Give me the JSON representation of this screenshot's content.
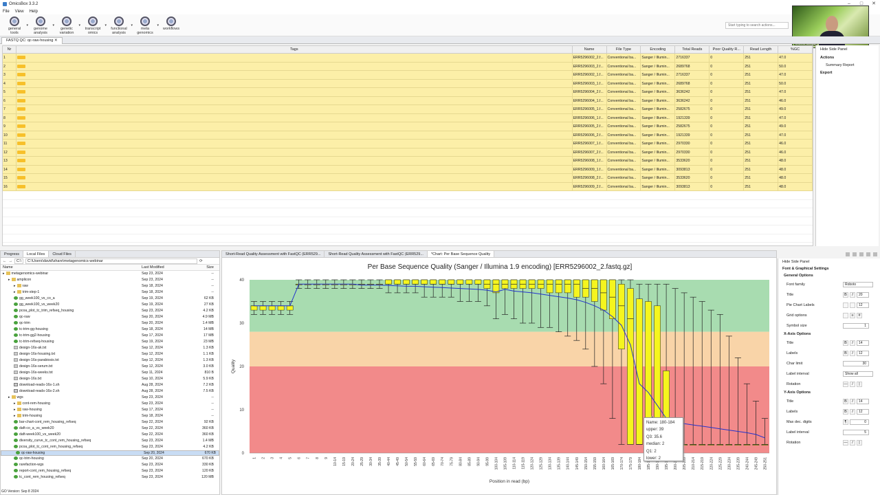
{
  "app": {
    "title": "OmicsBox 3.3.2"
  },
  "menu": [
    "File",
    "View",
    "Help"
  ],
  "toolbar": [
    {
      "label": "general\ntools",
      "icon": "general-tools-icon"
    },
    {
      "label": "genome\nanalysis",
      "icon": "genome-analysis-icon"
    },
    {
      "label": "genetic\nvariation",
      "icon": "genetic-variation-icon"
    },
    {
      "label": "transcript\nomics",
      "icon": "transcriptomics-icon"
    },
    {
      "label": "functional\nanalysis",
      "icon": "functional-analysis-icon"
    },
    {
      "label": "meta\ngenomics",
      "icon": "metagenomics-icon"
    },
    {
      "label": "workflows",
      "icon": "workflows-icon"
    }
  ],
  "search": {
    "placeholder": "Start typing to search actions..."
  },
  "webcam": {
    "name": "David Seide"
  },
  "doc_tab": {
    "label": "FASTQ QC: qc-raw-housing"
  },
  "table": {
    "columns": [
      "Nr",
      "Tags",
      "Name",
      "File Type",
      "Encoding",
      "Total Reads",
      "Poor Quality R...",
      "Read Length",
      "%GC"
    ],
    "rows": [
      [
        "1",
        "ERR5296002_2.f...",
        "Conventional ba...",
        "Sanger / Illumin...",
        "2716337",
        "0",
        "251",
        "47.0"
      ],
      [
        "2",
        "ERR5296003_2.f...",
        "Conventional ba...",
        "Sanger / Illumin...",
        "2689768",
        "0",
        "251",
        "50.0"
      ],
      [
        "3",
        "ERR5296002_1.f...",
        "Conventional ba...",
        "Sanger / Illumin...",
        "2716337",
        "0",
        "251",
        "47.0"
      ],
      [
        "4",
        "ERR5296003_1.f...",
        "Conventional ba...",
        "Sanger / Illumin...",
        "2689768",
        "0",
        "251",
        "50.0"
      ],
      [
        "5",
        "ERR5296004_2.f...",
        "Conventional ba...",
        "Sanger / Illumin...",
        "3636242",
        "0",
        "251",
        "47.0"
      ],
      [
        "6",
        "ERR5296004_1.f...",
        "Conventional ba...",
        "Sanger / Illumin...",
        "3636242",
        "0",
        "251",
        "46.0"
      ],
      [
        "7",
        "ERR5296005_1.f...",
        "Conventional ba...",
        "Sanger / Illumin...",
        "2582675",
        "0",
        "251",
        "49.0"
      ],
      [
        "8",
        "ERR5296006_1.f...",
        "Conventional ba...",
        "Sanger / Illumin...",
        "1921339",
        "0",
        "251",
        "47.0"
      ],
      [
        "9",
        "ERR5296005_2.f...",
        "Conventional ba...",
        "Sanger / Illumin...",
        "2582675",
        "0",
        "251",
        "49.0"
      ],
      [
        "10",
        "ERR5296006_2.f...",
        "Conventional ba...",
        "Sanger / Illumin...",
        "1921339",
        "0",
        "251",
        "47.0"
      ],
      [
        "11",
        "ERR5296007_1.f...",
        "Conventional ba...",
        "Sanger / Illumin...",
        "2970330",
        "0",
        "251",
        "46.0"
      ],
      [
        "12",
        "ERR5296007_2.f...",
        "Conventional ba...",
        "Sanger / Illumin...",
        "2970330",
        "0",
        "251",
        "46.0"
      ],
      [
        "13",
        "ERR5296008_1.f...",
        "Conventional ba...",
        "Sanger / Illumin...",
        "3533620",
        "0",
        "251",
        "48.0"
      ],
      [
        "14",
        "ERR5296009_1.f...",
        "Conventional ba...",
        "Sanger / Illumin...",
        "3093813",
        "0",
        "251",
        "48.0"
      ],
      [
        "15",
        "ERR5296008_2.f...",
        "Conventional ba...",
        "Sanger / Illumin...",
        "3533620",
        "0",
        "251",
        "48.0"
      ],
      [
        "16",
        "ERR5296009_2.f...",
        "Conventional ba...",
        "Sanger / Illumin...",
        "3093813",
        "0",
        "251",
        "48.0"
      ]
    ]
  },
  "right_panel": {
    "hide": "Hide Side Panel",
    "actions": "Actions",
    "summary": "Summary Report",
    "export": "Export"
  },
  "bottom_left": {
    "tabs": [
      "Progress",
      "Local Files",
      "Cloud Files"
    ],
    "drive": "C:\\",
    "path": "C:\\Users\\david\\share\\metagenomics-webinar",
    "columns": [
      "Name",
      "Last Modified",
      "Size"
    ],
    "files": [
      [
        "metagenomics-webinar",
        "Sep 23, 2024",
        "--",
        "fold",
        0
      ],
      [
        "amplicon",
        "Sep 23, 2024",
        "--",
        "fold",
        1
      ],
      [
        "raw",
        "Sep 18, 2024",
        "--",
        "fold",
        2
      ],
      [
        "trim-step-1",
        "Sep 18, 2024",
        "--",
        "fold",
        2
      ],
      [
        "gg_week100_vs_co_a",
        "Sep 19, 2024",
        "62 KB",
        "fqc",
        2
      ],
      [
        "gg_week100_vs_week20",
        "Sep 19, 2024",
        "27 KB",
        "fqc",
        2
      ],
      [
        "pcoa_plot_tc_trim_refseq_housing",
        "Sep 23, 2024",
        "4.2 KB",
        "fqc",
        2
      ],
      [
        "qc-raw",
        "Sep 20, 2024",
        "4.9 MB",
        "fqc",
        2
      ],
      [
        "qc-trim",
        "Sep 20, 2024",
        "1.4 MB",
        "fqc",
        2
      ],
      [
        "tc-trim-gg-housing",
        "Sep 18, 2024",
        "14 MB",
        "fqc",
        2
      ],
      [
        "tc-trim-gg2-housing",
        "Sep 17, 2024",
        "17 MB",
        "fqc",
        2
      ],
      [
        "tc-trim-refseq-housing",
        "Sep 19, 2024",
        "23 MB",
        "fqc",
        2
      ],
      [
        "design-16s-ak.txt",
        "Sep 12, 2024",
        "1.3 KB",
        "fdoc",
        2
      ],
      [
        "design-16s-housing.txt",
        "Sep 12, 2024",
        "1.1 KB",
        "fdoc",
        2
      ],
      [
        "design-16s-parabiosis.txt",
        "Sep 12, 2024",
        "1.3 KB",
        "fdoc",
        2
      ],
      [
        "design-16s-serum.txt",
        "Sep 12, 2024",
        "3.0 KB",
        "fdoc",
        2
      ],
      [
        "design-16s-weeks.txt",
        "Sep 11, 2024",
        "810 B",
        "fdoc",
        2
      ],
      [
        "design-16s.txt",
        "Sep 10, 2024",
        "5.9 KB",
        "fdoc",
        2
      ],
      [
        "download-reads-16s-1.sh",
        "Aug 28, 2024",
        "7.2 KB",
        "fsh",
        2
      ],
      [
        "download-reads-16s-2.sh",
        "Aug 28, 2024",
        "7.5 KB",
        "fsh",
        2
      ],
      [
        "wgs",
        "Sep 23, 2024",
        "--",
        "fold",
        1
      ],
      [
        "cont-rem-housing",
        "Sep 23, 2024",
        "--",
        "fold",
        2
      ],
      [
        "raw-housing",
        "Sep 17, 2024",
        "--",
        "fold",
        2
      ],
      [
        "trim-housing",
        "Sep 18, 2024",
        "--",
        "fold",
        2
      ],
      [
        "bar-chart-cont_rem_housing_refseq",
        "Sep 22, 2024",
        "92 KB",
        "fqc",
        2
      ],
      [
        "daft-co_a_vs_week20",
        "Sep 22, 2024",
        "360 KB",
        "fqc",
        2
      ],
      [
        "daft-week100_vs_week20",
        "Sep 22, 2024",
        "360 KB",
        "fqc",
        2
      ],
      [
        "diversity_curve_tc_cont_rem_housing_refseq",
        "Sep 23, 2024",
        "1.4 MB",
        "fqc",
        2
      ],
      [
        "pcoa_plot_tc_cont_rem_housing_refseq",
        "Sep 23, 2024",
        "4.2 KB",
        "fqc",
        2
      ],
      [
        "qc-raw-housing",
        "Sep 20, 2024",
        "670 KB",
        "fqc",
        2
      ],
      [
        "qc-trim-housing",
        "Sep 20, 2024",
        "670 KB",
        "fqc",
        2
      ],
      [
        "rarefaction-wgs",
        "Sep 23, 2024",
        "330 KB",
        "fqc",
        2
      ],
      [
        "report-cont_rem_housing_refseq",
        "Sep 23, 2024",
        "120 KB",
        "fqc",
        2
      ],
      [
        "tc_cont_rem_housing_refseq",
        "Sep 23, 2024",
        "120 MB",
        "fqc",
        2
      ]
    ],
    "selected": "qc-raw-housing",
    "status": "GO Version: Sep 8 2024"
  },
  "chart_tabs": [
    "Short-Read Quality Assessment with FastQC (ERR529...",
    "Short-Read Quality Assessment with FastQC (ERR529...",
    "*Chart: Per Base Sequence Quality"
  ],
  "colors": {
    "good": "#a8dcb0",
    "warn": "#f9d4a8",
    "bad": "#f28a8a",
    "box": "#f5f51e",
    "mean": "#2233cc"
  },
  "tooltip": {
    "lines": [
      "Name: 180-184",
      "upper: 39",
      "Q3: 35.6",
      "median: 2",
      "Q1: 2",
      "lower: 2"
    ]
  },
  "side_panel": {
    "hide": "Hide Side Panel",
    "section": "Font & Graphical Settings",
    "general": "General Options",
    "font_family": "Font family",
    "font_value": "Roboto",
    "title": "Title",
    "title_size": "20",
    "pie": "Pie Chart Labels",
    "pie_size": "12",
    "grid": "Grid options",
    "symbol": "Symbol size",
    "symbol_value": "1",
    "xaxis": "X-Axis Options",
    "x_title": "Title",
    "x_title_size": "14",
    "x_labels": "Labels",
    "x_labels_size": "12",
    "char_limit": "Char limit",
    "char_value": "30",
    "label_interval": "Label interval",
    "label_interval_value": "Show all",
    "rotation": "Rotation",
    "yaxis": "Y-Axis Options",
    "y_title": "Title",
    "y_title_size": "14",
    "y_labels": "Labels",
    "y_labels_size": "12",
    "max_dec": "Max dec. digits",
    "max_dec_value": "0",
    "y_interval": "Label interval",
    "y_interval_value": "5",
    "y_rotation": "Rotation"
  },
  "chart_data": {
    "type": "box",
    "title": "Per Base Sequence Quality (Sanger / Illumina 1.9 encoding) [ERR5296002_2.fastq.gz]",
    "xlabel": "Position in read (bp)",
    "ylabel": "Quality",
    "ylim": [
      0,
      40
    ],
    "yticks": [
      0,
      10,
      20,
      30,
      40
    ],
    "zones": [
      {
        "from": 28,
        "to": 40,
        "color": "good"
      },
      {
        "from": 20,
        "to": 28,
        "color": "warn"
      },
      {
        "from": 0,
        "to": 20,
        "color": "bad"
      }
    ],
    "categories": [
      "1",
      "2",
      "3",
      "4",
      "5",
      "6",
      "7",
      "8",
      "9",
      "10-14",
      "15-19",
      "20-24",
      "25-29",
      "30-34",
      "35-39",
      "40-44",
      "45-49",
      "50-54",
      "55-59",
      "60-64",
      "65-69",
      "70-74",
      "75-79",
      "80-84",
      "85-89",
      "90-94",
      "95-99",
      "100-104",
      "105-109",
      "110-114",
      "115-119",
      "120-124",
      "125-129",
      "130-134",
      "135-139",
      "140-144",
      "145-149",
      "150-154",
      "155-159",
      "160-164",
      "165-169",
      "170-174",
      "175-179",
      "180-184",
      "185-189",
      "190-194",
      "195-199",
      "200-204",
      "205-209",
      "210-214",
      "215-219",
      "220-224",
      "225-229",
      "230-234",
      "235-239",
      "240-244",
      "245-249",
      "250-251"
    ],
    "boxes": [
      {
        "q1": 33,
        "med": 34,
        "q3": 34,
        "lo": 32,
        "hi": 35
      },
      {
        "q1": 33,
        "med": 34,
        "q3": 34,
        "lo": 32,
        "hi": 35
      },
      {
        "q1": 33,
        "med": 34,
        "q3": 34,
        "lo": 32,
        "hi": 35
      },
      {
        "q1": 33,
        "med": 34,
        "q3": 34,
        "lo": 32,
        "hi": 35
      },
      {
        "q1": 33,
        "med": 34,
        "q3": 34,
        "lo": 32,
        "hi": 35
      },
      {
        "q1": 39,
        "med": 39,
        "q3": 39,
        "lo": 38,
        "hi": 40
      },
      {
        "q1": 39,
        "med": 39,
        "q3": 39,
        "lo": 38,
        "hi": 40
      },
      {
        "q1": 39,
        "med": 39,
        "q3": 39,
        "lo": 38,
        "hi": 40
      },
      {
        "q1": 39,
        "med": 39,
        "q3": 39,
        "lo": 38,
        "hi": 40
      },
      {
        "q1": 39,
        "med": 39,
        "q3": 39,
        "lo": 38,
        "hi": 40
      },
      {
        "q1": 39,
        "med": 39,
        "q3": 39,
        "lo": 38,
        "hi": 40
      },
      {
        "q1": 39,
        "med": 39,
        "q3": 39,
        "lo": 38,
        "hi": 40
      },
      {
        "q1": 39,
        "med": 39,
        "q3": 39,
        "lo": 38,
        "hi": 40
      },
      {
        "q1": 39,
        "med": 39,
        "q3": 39,
        "lo": 38,
        "hi": 40
      },
      {
        "q1": 39,
        "med": 39,
        "q3": 39,
        "lo": 38,
        "hi": 40
      },
      {
        "q1": 39,
        "med": 39,
        "q3": 40,
        "lo": 37,
        "hi": 40
      },
      {
        "q1": 39,
        "med": 39,
        "q3": 40,
        "lo": 37,
        "hi": 40
      },
      {
        "q1": 39,
        "med": 39,
        "q3": 40,
        "lo": 37,
        "hi": 40
      },
      {
        "q1": 39,
        "med": 39,
        "q3": 40,
        "lo": 37,
        "hi": 40
      },
      {
        "q1": 39,
        "med": 39,
        "q3": 40,
        "lo": 36,
        "hi": 40
      },
      {
        "q1": 39,
        "med": 39,
        "q3": 40,
        "lo": 36,
        "hi": 40
      },
      {
        "q1": 39,
        "med": 39,
        "q3": 40,
        "lo": 36,
        "hi": 40
      },
      {
        "q1": 39,
        "med": 39,
        "q3": 40,
        "lo": 36,
        "hi": 40
      },
      {
        "q1": 39,
        "med": 39,
        "q3": 40,
        "lo": 35,
        "hi": 40
      },
      {
        "q1": 39,
        "med": 39,
        "q3": 40,
        "lo": 35,
        "hi": 40
      },
      {
        "q1": 39,
        "med": 39,
        "q3": 40,
        "lo": 35,
        "hi": 40
      },
      {
        "q1": 38,
        "med": 39,
        "q3": 40,
        "lo": 34,
        "hi": 40
      },
      {
        "q1": 37,
        "med": 39,
        "q3": 40,
        "lo": 31,
        "hi": 40
      },
      {
        "q1": 38,
        "med": 39,
        "q3": 40,
        "lo": 32,
        "hi": 40
      },
      {
        "q1": 38,
        "med": 39,
        "q3": 40,
        "lo": 31,
        "hi": 40
      },
      {
        "q1": 38,
        "med": 39,
        "q3": 40,
        "lo": 30,
        "hi": 40
      },
      {
        "q1": 38,
        "med": 39,
        "q3": 40,
        "lo": 30,
        "hi": 40
      },
      {
        "q1": 38,
        "med": 39,
        "q3": 40,
        "lo": 29,
        "hi": 40
      },
      {
        "q1": 37,
        "med": 39,
        "q3": 40,
        "lo": 29,
        "hi": 40
      },
      {
        "q1": 37,
        "med": 39,
        "q3": 40,
        "lo": 28,
        "hi": 40
      },
      {
        "q1": 37,
        "med": 39,
        "q3": 40,
        "lo": 27,
        "hi": 40
      },
      {
        "q1": 36,
        "med": 39,
        "q3": 40,
        "lo": 26,
        "hi": 40
      },
      {
        "q1": 36,
        "med": 38,
        "q3": 40,
        "lo": 24,
        "hi": 40
      },
      {
        "q1": 35,
        "med": 38,
        "q3": 40,
        "lo": 20,
        "hi": 40
      },
      {
        "q1": 33,
        "med": 37,
        "q3": 40,
        "lo": 16,
        "hi": 40
      },
      {
        "q1": 31,
        "med": 36,
        "q3": 40,
        "lo": 8,
        "hi": 40
      },
      {
        "q1": 24,
        "med": 34,
        "q3": 39,
        "lo": 2,
        "hi": 40
      },
      {
        "q1": 2,
        "med": 31,
        "q3": 38,
        "lo": 2,
        "hi": 40
      },
      {
        "q1": 2,
        "med": 2,
        "q3": 35.6,
        "lo": 2,
        "hi": 39
      },
      {
        "q1": 2,
        "med": 2,
        "q3": 35,
        "lo": 2,
        "hi": 39
      },
      {
        "q1": 2,
        "med": 2,
        "q3": 34,
        "lo": 2,
        "hi": 39
      },
      {
        "q1": 2,
        "med": 2,
        "q3": 19,
        "lo": 2,
        "hi": 39
      },
      {
        "q1": 2,
        "med": 2,
        "q3": 2,
        "lo": 2,
        "hi": 38
      },
      {
        "q1": 2,
        "med": 2,
        "q3": 2,
        "lo": 2,
        "hi": 37
      },
      {
        "q1": 2,
        "med": 2,
        "q3": 2,
        "lo": 2,
        "hi": 36
      },
      {
        "q1": 2,
        "med": 2,
        "q3": 2,
        "lo": 2,
        "hi": 35
      },
      {
        "q1": 2,
        "med": 2,
        "q3": 2,
        "lo": 2,
        "hi": 33
      },
      {
        "q1": 2,
        "med": 2,
        "q3": 2,
        "lo": 2,
        "hi": 32
      },
      {
        "q1": 2,
        "med": 2,
        "q3": 2,
        "lo": 2,
        "hi": 27
      },
      {
        "q1": 2,
        "med": 2,
        "q3": 2,
        "lo": 2,
        "hi": 22
      },
      {
        "q1": 2,
        "med": 2,
        "q3": 2,
        "lo": 2,
        "hi": 16
      },
      {
        "q1": 2,
        "med": 2,
        "q3": 2,
        "lo": 2,
        "hi": 12
      },
      {
        "q1": 2,
        "med": 2,
        "q3": 2,
        "lo": 2,
        "hi": 8
      }
    ],
    "mean": [
      34,
      34,
      34,
      34,
      34,
      39,
      39,
      39,
      39,
      39,
      39,
      39,
      38.8,
      38.8,
      38.8,
      38.7,
      38.6,
      38.5,
      38.5,
      38.4,
      38.3,
      38.2,
      38.1,
      38,
      37.9,
      37.8,
      37.6,
      37.2,
      37.8,
      37.4,
      37.2,
      37,
      36.7,
      36.4,
      36.1,
      35.8,
      35.4,
      34.8,
      34,
      33,
      31.5,
      29.5,
      25,
      16,
      14,
      11,
      8,
      7,
      6.8,
      6.5,
      6.2,
      5.9,
      5.6,
      5.3,
      5,
      4.7,
      4.3,
      3.5
    ]
  }
}
